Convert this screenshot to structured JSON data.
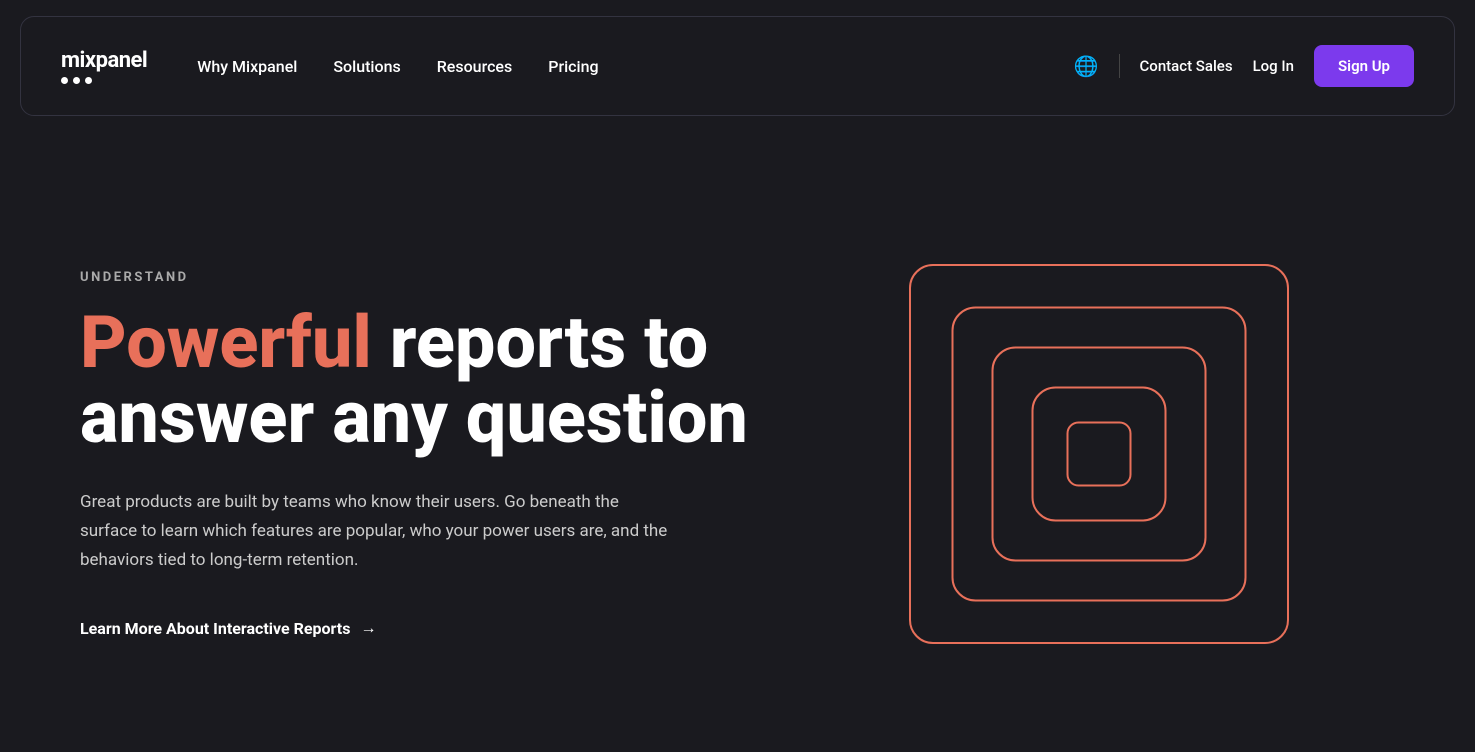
{
  "nav": {
    "logo_text": "mixpanel",
    "links": [
      {
        "label": "Why Mixpanel",
        "id": "why-mixpanel"
      },
      {
        "label": "Solutions",
        "id": "solutions"
      },
      {
        "label": "Resources",
        "id": "resources"
      },
      {
        "label": "Pricing",
        "id": "pricing"
      }
    ],
    "contact_sales_label": "Contact Sales",
    "login_label": "Log In",
    "signup_label": "Sign Up"
  },
  "hero": {
    "section_label": "UNDERSTAND",
    "title_accent": "Powerful",
    "title_rest": " reports to answer any question",
    "description": "Great products are built by teams who know their users. Go beneath the surface to learn which features are popular, who your power users are, and the behaviors tied to long-term retention.",
    "cta_label": "Learn More About Interactive Reports",
    "cta_arrow": "→"
  },
  "graphic": {
    "square_sizes": [
      380,
      300,
      220,
      140,
      70
    ]
  },
  "colors": {
    "accent": "#e8705a",
    "purple": "#7c3aed",
    "bg": "#1a1a1f"
  }
}
